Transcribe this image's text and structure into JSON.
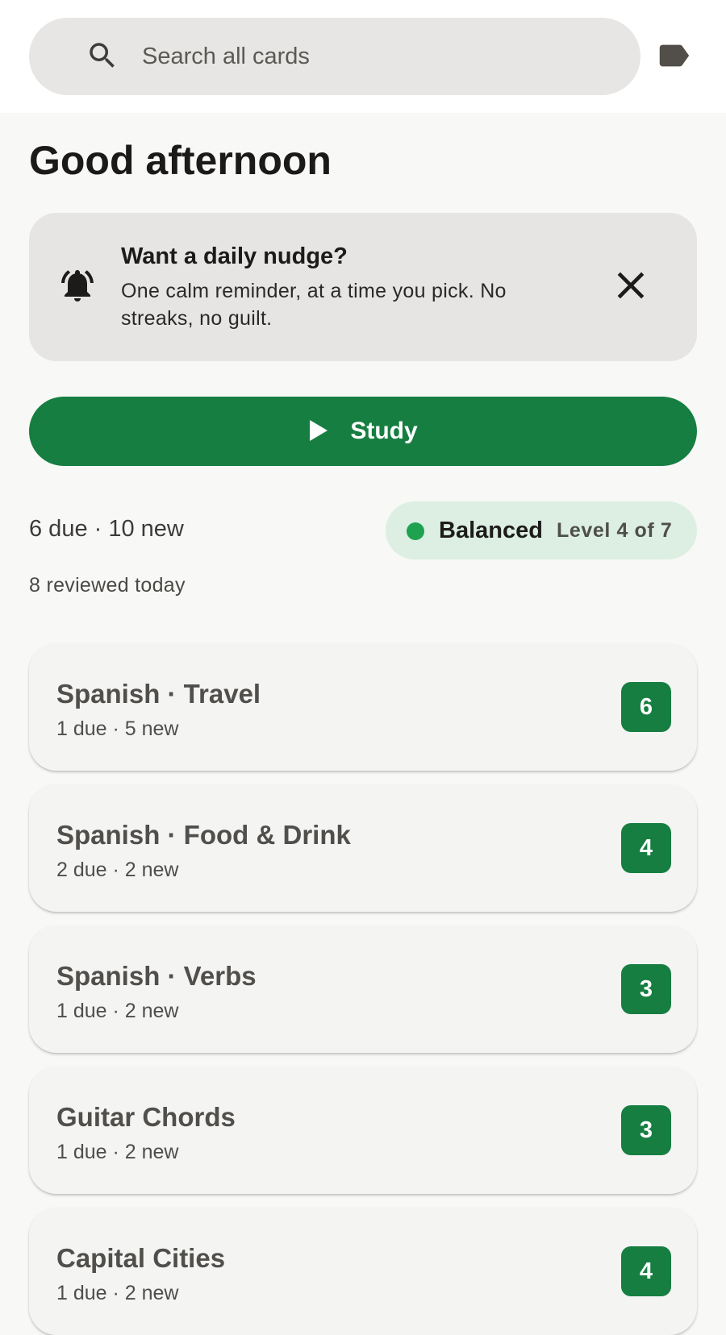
{
  "search": {
    "placeholder": "Search all cards"
  },
  "greeting": "Good afternoon",
  "nudge": {
    "title": "Want a daily nudge?",
    "body": "One calm reminder, at a time you pick. No streaks, no guilt."
  },
  "study": {
    "label": "Study"
  },
  "summary": {
    "stats": "6 due · 10 new",
    "reviewed": "8 reviewed today",
    "mode": "Balanced",
    "level": "Level 4 of 7",
    "mode_color": "#1ea24f"
  },
  "decks": [
    {
      "name": "Spanish · Travel",
      "meta": "1 due · 5 new",
      "count": "6"
    },
    {
      "name": "Spanish · Food & Drink",
      "meta": "2 due · 2 new",
      "count": "4"
    },
    {
      "name": "Spanish · Verbs",
      "meta": "1 due · 2 new",
      "count": "3"
    },
    {
      "name": "Guitar Chords",
      "meta": "1 due · 2 new",
      "count": "3"
    },
    {
      "name": "Capital Cities",
      "meta": "1 due · 2 new",
      "count": "4"
    }
  ],
  "colors": {
    "accent": "#167e41",
    "pill_bg": "#dcefe2",
    "card_bg": "#f4f4f3"
  },
  "icons": {
    "search": "search-icon",
    "label": "label-icon",
    "bell": "bell-icon",
    "close": "close-icon",
    "play": "play-icon"
  }
}
